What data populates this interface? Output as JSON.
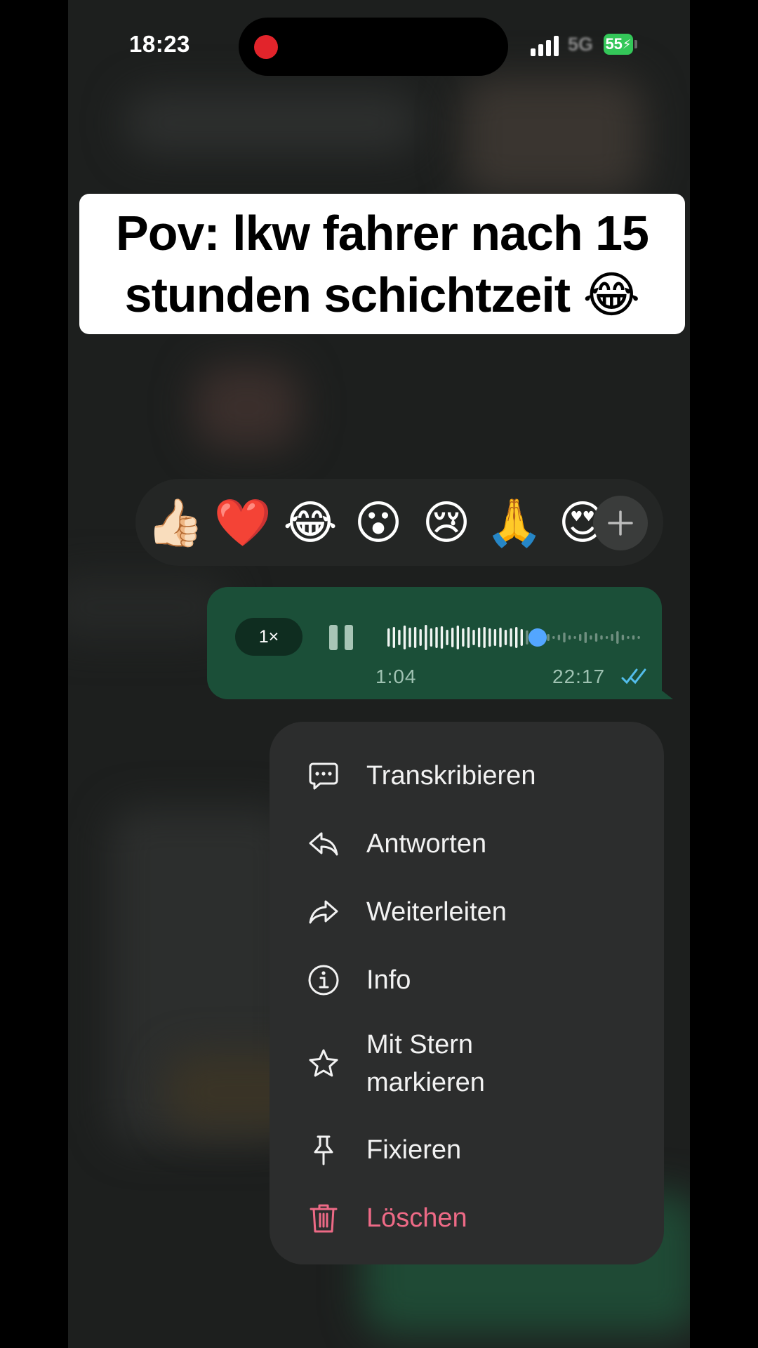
{
  "status_bar": {
    "time": "18:23",
    "network": "5G",
    "battery": "55"
  },
  "caption": {
    "line1": "Pov: lkw fahrer nach 15",
    "line2": "stunden schichtzeit 😂"
  },
  "reactions": [
    "👍🏻",
    "❤️",
    "😂",
    "😮",
    "😢",
    "🙏",
    "😍"
  ],
  "voice_message": {
    "speed": "1×",
    "duration": "1:04",
    "time": "22:17",
    "progress": 0.55,
    "status": "read"
  },
  "menu": {
    "items": [
      {
        "label": "Transkribieren",
        "icon": "transcribe-icon"
      },
      {
        "label": "Antworten",
        "icon": "reply-icon"
      },
      {
        "label": "Weiterleiten",
        "icon": "forward-icon"
      },
      {
        "label": "Info",
        "icon": "info-icon"
      },
      {
        "label": "Mit Stern\nmarkieren",
        "icon": "star-icon"
      },
      {
        "label": "Fixieren",
        "icon": "pin-icon"
      },
      {
        "label": "Löschen",
        "icon": "trash-icon",
        "color": "#ee6a86"
      }
    ]
  },
  "colors": {
    "bubble": "#1b4f38",
    "menu_bg": "#2c2d2d",
    "danger": "#ee6a86",
    "knob": "#53a6ff"
  }
}
